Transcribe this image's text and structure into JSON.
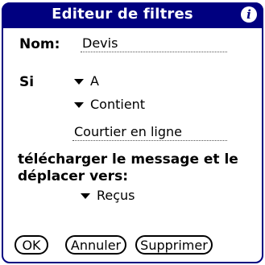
{
  "title": "Editeur de filtres",
  "info_icon": "info-icon",
  "name": {
    "label": "Nom:",
    "value": "Devis"
  },
  "condition": {
    "label": "Si",
    "field_option": "A",
    "operator_option": "Contient",
    "value": "Courtier en ligne"
  },
  "action": {
    "description": "télécharger le message et le déplacer vers:",
    "folder_option": "Reçus"
  },
  "buttons": {
    "ok": "OK",
    "cancel": "Annuler",
    "delete": "Supprimer"
  },
  "colors": {
    "title_bar": "#000080",
    "text": "#000000",
    "background": "#ffffff"
  }
}
